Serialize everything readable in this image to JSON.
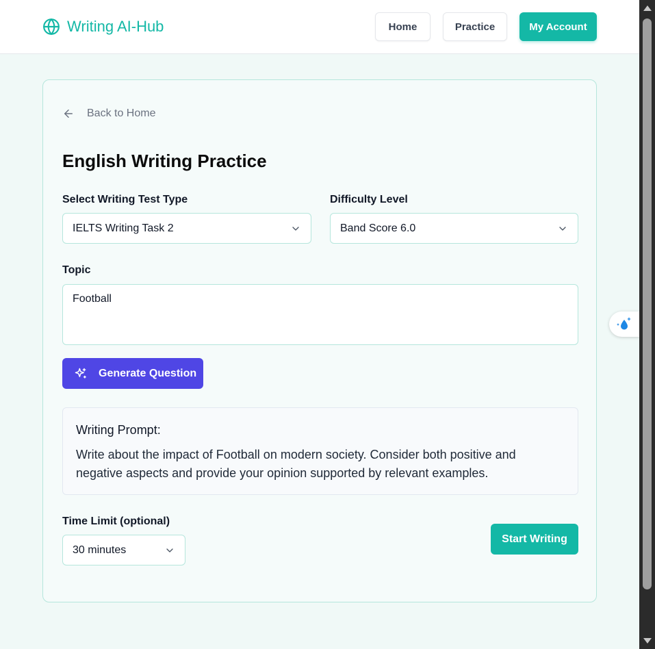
{
  "header": {
    "brand": "Writing AI-Hub",
    "nav": {
      "home": "Home",
      "practice": "Practice",
      "account": "My Account"
    }
  },
  "main": {
    "back_label": "Back to Home",
    "title": "English Writing Practice",
    "test_type": {
      "label": "Select Writing Test Type",
      "value": "IELTS Writing Task 2"
    },
    "difficulty": {
      "label": "Difficulty Level",
      "value": "Band Score 6.0"
    },
    "topic": {
      "label": "Topic",
      "value": "Football"
    },
    "generate_label": "Generate Question",
    "prompt": {
      "title": "Writing Prompt:",
      "text": "Write about the impact of Football on modern society. Consider both positive and negative aspects and provide your opinion supported by relevant examples."
    },
    "time_limit": {
      "label": "Time Limit (optional)",
      "value": "30 minutes"
    },
    "start_label": "Start Writing"
  },
  "colors": {
    "accent": "#14b8a6",
    "primary_button": "#4f46e5",
    "background": "#f0f9f7"
  }
}
